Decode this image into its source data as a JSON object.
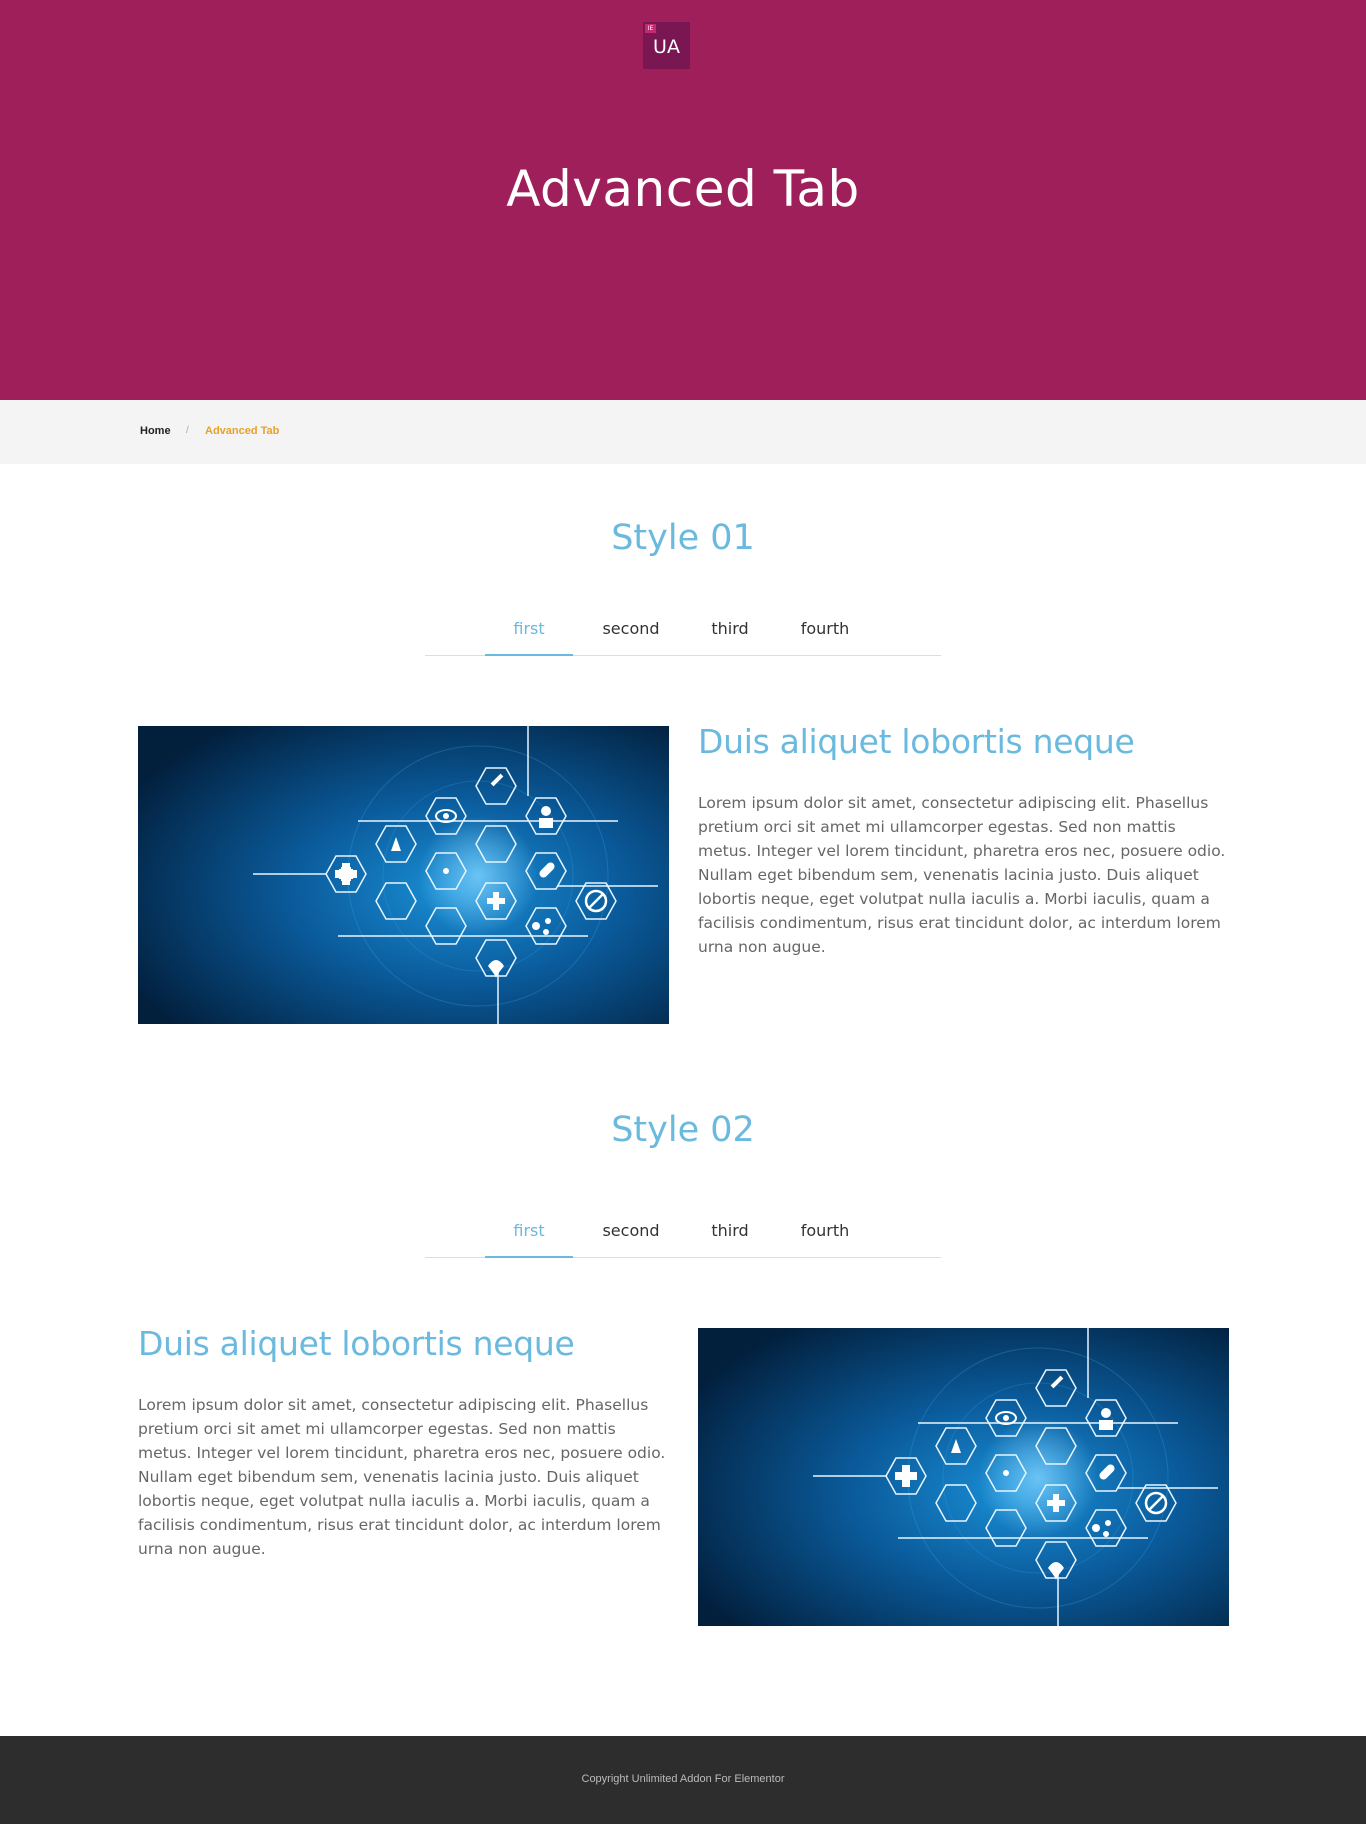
{
  "header": {
    "logo_badge": "IE",
    "logo_text": "UA",
    "title": "Advanced Tab"
  },
  "breadcrumb": {
    "home": "Home",
    "separator": "/",
    "current": "Advanced Tab"
  },
  "style01": {
    "title": "Style 01",
    "tabs": [
      {
        "label": "first",
        "active": true
      },
      {
        "label": "second",
        "active": false
      },
      {
        "label": "third",
        "active": false
      },
      {
        "label": "fourth",
        "active": false
      }
    ],
    "heading": "Duis aliquet lobortis neque",
    "body": "Lorem ipsum dolor sit amet, consectetur adipiscing elit. Phasellus pretium orci sit amet mi ullamcorper egestas. Sed non mattis metus. Integer vel lorem tincidunt, pharetra eros nec, posuere odio. Nullam eget bibendum sem, venenatis lacinia justo. Duis aliquet lobortis neque, eget volutpat nulla iaculis a. Morbi iaculis, quam a facilisis condimentum, risus erat tincidunt dolor, ac interdum lorem urna non augue."
  },
  "style02": {
    "title": "Style 02",
    "tabs": [
      {
        "label": "first",
        "active": true
      },
      {
        "label": "second",
        "active": false
      },
      {
        "label": "third",
        "active": false
      },
      {
        "label": "fourth",
        "active": false
      }
    ],
    "heading": "Duis aliquet lobortis neque",
    "body": "Lorem ipsum dolor sit amet, consectetur adipiscing elit. Phasellus pretium orci sit amet mi ullamcorper egestas. Sed non mattis metus. Integer vel lorem tincidunt, pharetra eros nec, posuere odio. Nullam eget bibendum sem, venenatis lacinia justo. Duis aliquet lobortis neque, eget volutpat nulla iaculis a. Morbi iaculis, quam a facilisis condimentum, risus erat tincidunt dolor, ac interdum lorem urna non augue."
  },
  "footer": {
    "copyright": "Copyright Unlimited Addon For Elementor"
  },
  "colors": {
    "hero_bg": "#9e1f59",
    "accent_blue": "#6ab9de",
    "breadcrumb_current": "#e8a02a",
    "footer_bg": "#2d2d2d"
  },
  "image_icons": [
    "plus-icon",
    "flask-icon",
    "eye-icon",
    "syringe-icon",
    "doctor-icon",
    "atom-icon",
    "microscope-icon",
    "pill-icon",
    "no-icon",
    "caduceus-icon",
    "brain-icon",
    "medkit-icon",
    "molecule-icon",
    "heart-icon"
  ]
}
